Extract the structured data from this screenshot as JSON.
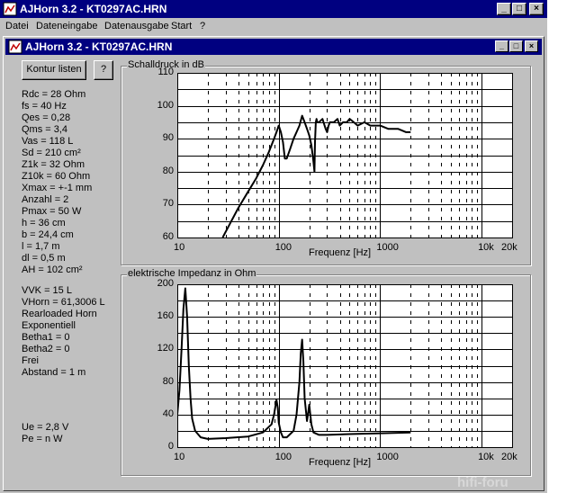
{
  "app": {
    "title": "AJHorn 3.2 - KT0297AC.HRN"
  },
  "window_buttons": {
    "minimize": "_",
    "maximize": "□",
    "close": "×"
  },
  "menu": [
    "Datei",
    "Dateneingabe",
    "Datenausgabe",
    "Start",
    "?"
  ],
  "child": {
    "title": "AJHorn 3.2 - KT0297AC.HRN"
  },
  "buttons": {
    "contour": "Kontur listen",
    "help": "?"
  },
  "params": [
    "Rdc = 28 Ohm",
    "fs = 40 Hz",
    "Qes = 0,28",
    "Qms = 3,4",
    "Vas = 118 L",
    "Sd = 210 cm²",
    "Z1k = 32 Ohm",
    "Z10k = 60 Ohm",
    "Xmax = +-1 mm",
    "Anzahl = 2",
    "Pmax = 50 W",
    "h = 36 cm",
    "b = 24,4 cm",
    "l = 1,7 m",
    "dl = 0,5 m",
    "AH = 102 cm²"
  ],
  "params2": [
    "VVK = 15 L",
    "VHorn = 61,3006 L",
    "Rearloaded Horn",
    "Exponentiell",
    "Betha1 = 0",
    "Betha2 = 0",
    "Frei",
    "Abstand = 1 m"
  ],
  "params3": [
    "Ue = 2,8 V",
    "Pe = n W"
  ],
  "watermark": "hifi-foru",
  "chart_data": [
    {
      "type": "line",
      "title": "Schalldruck in dB",
      "xlabel": "Frequenz [Hz]",
      "ylabel": "",
      "xscale": "log",
      "xlim": [
        10,
        20000
      ],
      "ylim": [
        60,
        110
      ],
      "yticks": [
        "110",
        "100",
        "90",
        "80",
        "70",
        "60"
      ],
      "xticks": [
        "10",
        "100",
        "1000",
        "10k",
        "20k"
      ],
      "grid": true,
      "x": [
        28,
        40,
        50,
        60,
        70,
        80,
        90,
        95,
        100,
        105,
        110,
        115,
        120,
        130,
        140,
        150,
        160,
        170,
        180,
        190,
        195,
        200,
        210,
        220,
        225,
        228,
        232,
        236,
        240,
        250,
        270,
        290,
        300,
        310,
        320,
        350,
        380,
        400,
        430,
        470,
        500,
        550,
        600,
        700,
        800,
        900,
        1000,
        1200,
        1500,
        1800,
        2000
      ],
      "y": [
        60,
        69,
        74,
        78,
        82,
        86,
        90,
        92,
        94,
        92,
        89,
        84,
        84,
        87,
        90,
        92,
        94,
        97,
        95,
        93,
        92,
        91,
        88,
        83,
        80,
        89,
        95,
        96,
        95,
        95,
        96,
        93,
        92,
        94,
        95,
        95,
        96,
        94,
        95,
        95,
        96,
        95,
        94,
        95,
        94,
        94,
        94,
        93,
        93,
        92,
        92
      ]
    },
    {
      "type": "line",
      "title": "elektrische Impedanz in Ohm",
      "xlabel": "Frequenz [Hz]",
      "ylabel": "",
      "xscale": "log",
      "xlim": [
        10,
        20000
      ],
      "ylim": [
        0,
        200
      ],
      "yticks": [
        "200",
        "160",
        "120",
        "80",
        "40",
        "0"
      ],
      "xticks": [
        "10",
        "100",
        "1000",
        "10k",
        "20k"
      ],
      "grid": true,
      "x": [
        10,
        10.5,
        11,
        11.5,
        12,
        12.5,
        13,
        13.5,
        14,
        15,
        17,
        20,
        30,
        50,
        70,
        85,
        90,
        95,
        98,
        100,
        105,
        110,
        120,
        140,
        150,
        160,
        165,
        170,
        175,
        180,
        190,
        195,
        200,
        205,
        210,
        220,
        250,
        300,
        500,
        1000,
        2000
      ],
      "y": [
        40,
        70,
        120,
        170,
        195,
        160,
        100,
        60,
        35,
        20,
        12,
        10,
        11,
        13,
        18,
        28,
        40,
        58,
        48,
        30,
        18,
        12,
        12,
        20,
        40,
        80,
        115,
        132,
        105,
        60,
        32,
        42,
        52,
        40,
        28,
        18,
        15,
        15,
        16,
        17,
        18
      ]
    }
  ]
}
